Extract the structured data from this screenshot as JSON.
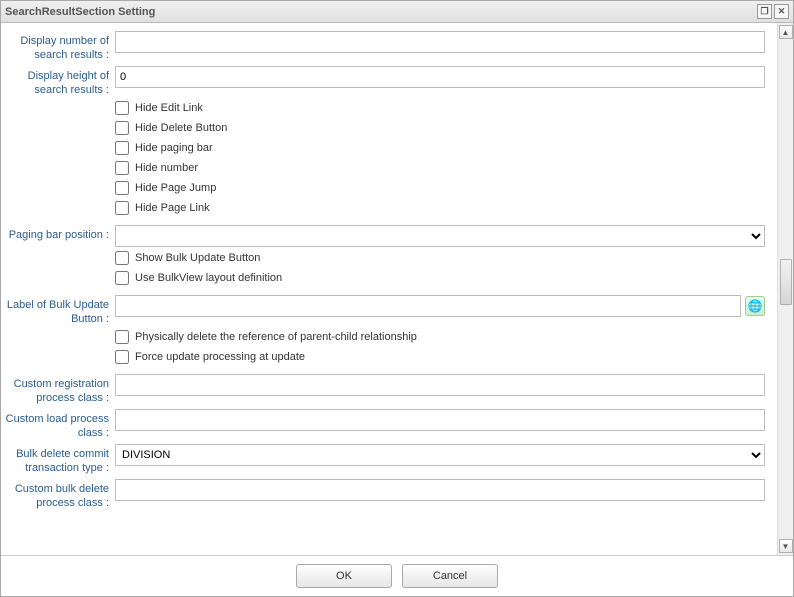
{
  "window": {
    "title": "SearchResultSection Setting"
  },
  "fields": {
    "display_number_label": "Display number of search results :",
    "display_number_value": "",
    "display_height_label": "Display height of search results :",
    "display_height_value": "0",
    "paging_bar_position_label": "Paging bar position :",
    "paging_bar_position_value": "",
    "label_bulk_update_label": "Label of Bulk Update Button :",
    "label_bulk_update_value": "",
    "custom_reg_label": "Custom registration process class :",
    "custom_reg_value": "",
    "custom_load_label": "Custom load process class :",
    "custom_load_value": "",
    "bulk_delete_tx_label": "Bulk delete commit transaction type :",
    "bulk_delete_tx_value": "DIVISION",
    "custom_bulk_delete_label": "Custom bulk delete process class :",
    "custom_bulk_delete_value": ""
  },
  "checkboxes": {
    "hide_edit_link": "Hide Edit Link",
    "hide_delete_button": "Hide Delete Button",
    "hide_paging_bar": "Hide paging bar",
    "hide_number": "Hide number",
    "hide_page_jump": "Hide Page Jump",
    "hide_page_link": "Hide Page Link",
    "show_bulk_update": "Show Bulk Update Button",
    "use_bulkview_layout": "Use BulkView layout definition",
    "physically_delete": "Physically delete the reference of parent-child relationship",
    "force_update": "Force update processing at update"
  },
  "footer": {
    "ok": "OK",
    "cancel": "Cancel"
  }
}
